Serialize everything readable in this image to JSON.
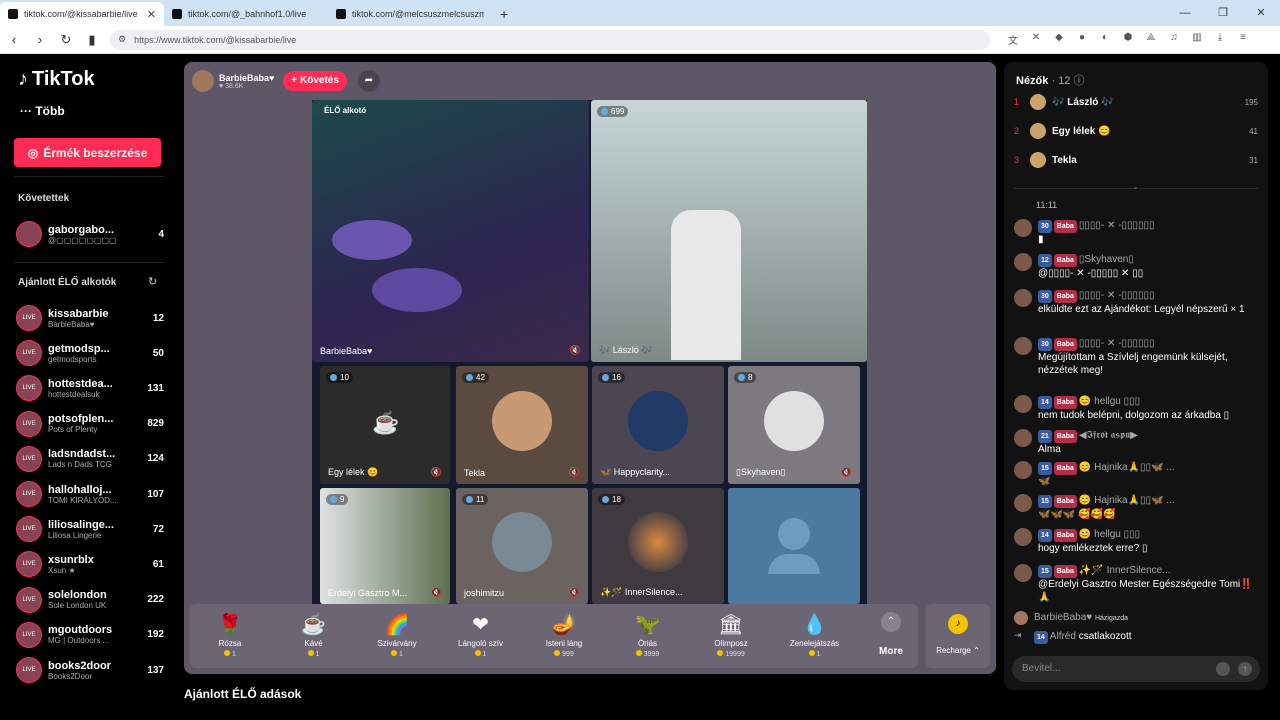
{
  "browser": {
    "tabs": [
      {
        "title": "tiktok.com/@kissabarbie/live",
        "close": "✕"
      },
      {
        "title": "tiktok.com/@_bahnhof1.0/live",
        "close": ""
      },
      {
        "title": "tiktok.com/@melcsuszmelcsuszmelcs",
        "close": ""
      }
    ],
    "new_tab": "+",
    "url": "https://www.tiktok.com/@kissabarbie/live"
  },
  "sidebar": {
    "logo": "TikTok",
    "more": "Több",
    "coins_button": "Érmék beszerzése",
    "following_title": "Követettek",
    "following": [
      {
        "name": "gaborgabo...",
        "sub": "@▢▢▢▢▢▢▢▢",
        "count": "4"
      }
    ],
    "recommended_title": "Ajánlott ÉLŐ alkotók",
    "recommended": [
      {
        "name": "kissabarbie",
        "sub": "BarbieBaba♥",
        "count": "12"
      },
      {
        "name": "getmodsp...",
        "sub": "getmodsports",
        "count": "50"
      },
      {
        "name": "hottestdea...",
        "sub": "hottestdealsuk",
        "count": "131"
      },
      {
        "name": "potsofplen...",
        "sub": "Pots of Plenty",
        "count": "829"
      },
      {
        "name": "ladsndadst...",
        "sub": "Lads n Dads TCG",
        "count": "124"
      },
      {
        "name": "hallohalloj...",
        "sub": "TOMI KIRÁLYOD...",
        "count": "107"
      },
      {
        "name": "liliosalinge...",
        "sub": "Liliosa Lingerie",
        "count": "72"
      },
      {
        "name": "xsunrblx",
        "sub": "Xsun ★",
        "count": "61"
      },
      {
        "name": "solelondon",
        "sub": "Sole London UK",
        "count": "222"
      },
      {
        "name": "mgoutdoors",
        "sub": "MG | Outdoors ...",
        "count": "192"
      },
      {
        "name": "books2door",
        "sub": "Books2Door",
        "count": "137"
      }
    ]
  },
  "live": {
    "host_name": "BarbieBaba♥",
    "host_likes": "♥ 38.6K",
    "follow_button": "+ Követés",
    "creator_tag": "ÉLŐ alkotó",
    "cells": [
      {
        "name": "BarbieBaba♥",
        "count": ""
      },
      {
        "name": "🎶 László 🎶",
        "count": "699"
      },
      {
        "name": "Egy lélek 😊",
        "count": "10"
      },
      {
        "name": "Tekla",
        "count": "42"
      },
      {
        "name": "🦋 Happyclarity...",
        "count": "16"
      },
      {
        "name": "▯Skyhaven▯",
        "count": "8"
      },
      {
        "name": "Erdelyi Gasztro M...",
        "count": "9"
      },
      {
        "name": "joshimitzu",
        "count": "11"
      },
      {
        "name": "✨🪄 InnerSilence...",
        "count": "18"
      }
    ],
    "gifts": [
      {
        "name": "Rózsa",
        "price": "1",
        "icon": "🌹"
      },
      {
        "name": "Kávé",
        "price": "1",
        "icon": "☕"
      },
      {
        "name": "Szivárvány",
        "price": "1",
        "icon": "🌈"
      },
      {
        "name": "Lángoló szív",
        "price": "1",
        "icon": "❤"
      },
      {
        "name": "Isteni láng",
        "price": "999",
        "icon": "🪔"
      },
      {
        "name": "Óriás",
        "price": "3999",
        "icon": "🦖"
      },
      {
        "name": "Olimposz",
        "price": "19999",
        "icon": "🏛"
      },
      {
        "name": "Zenelejátszás",
        "price": "1",
        "icon": "💧"
      }
    ],
    "more_label": "More",
    "recharge_label": "Recharge ⌃",
    "recommended_title": "Ajánlott ÉLŐ adások"
  },
  "chat": {
    "viewers_title": "Nézők",
    "viewers_count": "· 12",
    "top": [
      {
        "rank": "1",
        "name": "🎶 László 🎶",
        "value": "195"
      },
      {
        "rank": "2",
        "name": "Egy lélek 😊",
        "value": "41"
      },
      {
        "rank": "3",
        "name": "Tekla",
        "value": "31"
      }
    ],
    "time": "11:11",
    "messages": [
      {
        "level": "30",
        "fan": "Baba",
        "user": "▯▯▯▯- ✕ -▯▯▯▯▯▯",
        "text": "▮"
      },
      {
        "level": "12",
        "fan": "Baba",
        "user": "▯Skyhaven▯",
        "text": "@▯▯▯▯- ✕ -▯▯▯▯▯ ✕ ▯▯"
      },
      {
        "level": "30",
        "fan": "Baba",
        "user": "▯▯▯▯- ✕ -▯▯▯▯▯▯",
        "text": "elküldte ezt az Ajándékot: Legyél népszerű × 1"
      },
      {
        "level": "30",
        "fan": "Baba",
        "user": "▯▯▯▯- ✕ -▯▯▯▯▯▯",
        "text": "Megújítottam a Szívlelj engemünk külsejét, nézzétek meg!"
      },
      {
        "level": "14",
        "fan": "Baba",
        "user": "😊 hellgu ▯▯▯",
        "text": "nem tudok belépni, dolgozom az árkadba ▯"
      },
      {
        "level": "21",
        "fan": "Baba",
        "user": "◀𝕴𝖋𝖗𝖔́𝖙 𝖆𝖘𝖕𝖚̈▶",
        "text": "Alma"
      },
      {
        "level": "15",
        "fan": "Baba",
        "user": "😊 Hajnika🙏▯▯🦋 ...",
        "text": "🦋"
      },
      {
        "level": "15",
        "fan": "Baba",
        "user": "😊 Hajnika🙏▯▯🦋 ...",
        "text": "🦋🦋🦋 🥰🥰🥰"
      },
      {
        "level": "14",
        "fan": "Baba",
        "user": "😊 hellgu ▯▯▯",
        "text": "hogy emlékeztek erre? ▯"
      },
      {
        "level": "15",
        "fan": "Baba",
        "user": "✨🪄 InnerSilence...",
        "text": "@Erdelyi Gasztro Mester Egészségedre Tomi‼️🙏"
      }
    ],
    "host_line": {
      "user": "BarbieBaba♥",
      "tag": "Házigazda"
    },
    "join_line": {
      "level": "14",
      "user": "Alfréd",
      "text": "csatlakozott"
    },
    "input_placeholder": "Bevitel..."
  }
}
